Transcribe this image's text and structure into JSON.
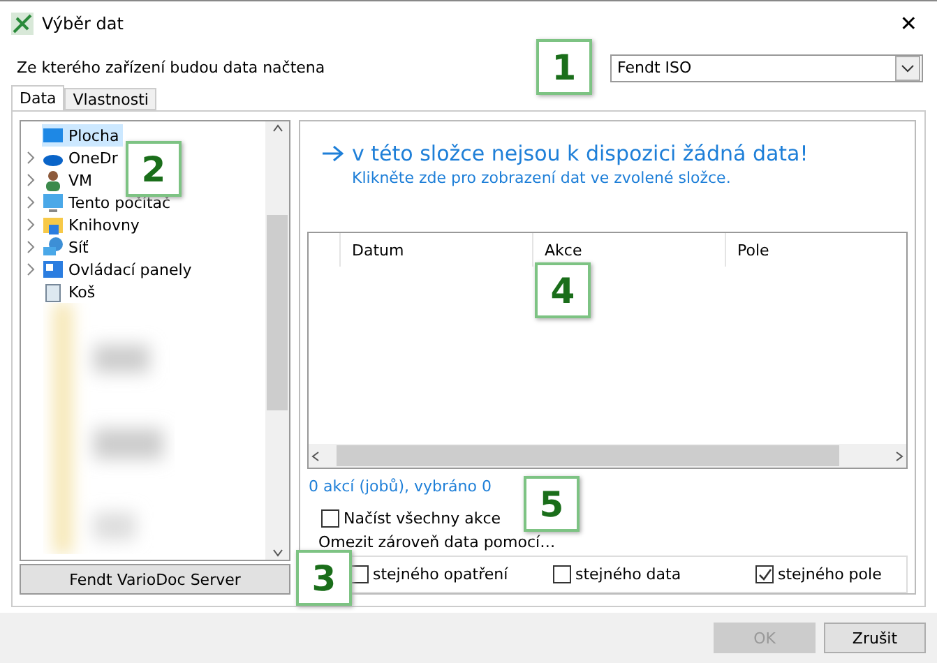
{
  "window": {
    "title": "Výběr dat",
    "close": "✕"
  },
  "device": {
    "label": "Ze kterého zařízení budou data načtena",
    "value": "Fendt ISO"
  },
  "tabs": [
    {
      "label": "Data",
      "selected": true
    },
    {
      "label": "Vlastnosti",
      "selected": false
    }
  ],
  "tree": {
    "items": [
      {
        "label": "Plocha",
        "kind": "desktop",
        "selected": true,
        "expandable": false
      },
      {
        "label": "OneDr",
        "kind": "cloud",
        "selected": false,
        "expandable": true
      },
      {
        "label": "VM",
        "kind": "user",
        "selected": false,
        "expandable": true
      },
      {
        "label": "Tento počítač",
        "kind": "monitor",
        "selected": false,
        "expandable": true
      },
      {
        "label": "Knihovny",
        "kind": "folder",
        "selected": false,
        "expandable": true
      },
      {
        "label": "Síť",
        "kind": "network",
        "selected": false,
        "expandable": true
      },
      {
        "label": "Ovládací panely",
        "kind": "panel",
        "selected": false,
        "expandable": true
      },
      {
        "label": "Koš",
        "kind": "bin",
        "selected": false,
        "expandable": false
      }
    ]
  },
  "server_button": "Fendt VarioDoc Server",
  "message": {
    "heading": "v této složce nejsou k dispozici žádná data!",
    "link": "Klikněte zde pro zobrazení dat ve zvolené složce."
  },
  "table": {
    "columns": [
      "Datum",
      "Akce",
      "Pole"
    ]
  },
  "status": "0 akcí (jobů), vybráno 0",
  "load_all": {
    "label": "Načíst všechny akce",
    "checked": false
  },
  "limit": {
    "legend": "Omezit zároveň data pomocí…",
    "options": [
      {
        "label": "stejného opatření",
        "checked": false
      },
      {
        "label": "stejného data",
        "checked": false
      },
      {
        "label": "stejného pole",
        "checked": true
      }
    ]
  },
  "buttons": [
    {
      "label": "OK",
      "disabled": true
    },
    {
      "label": "Zrušit",
      "disabled": false
    }
  ],
  "callouts": [
    "1",
    "2",
    "3",
    "4",
    "5"
  ]
}
